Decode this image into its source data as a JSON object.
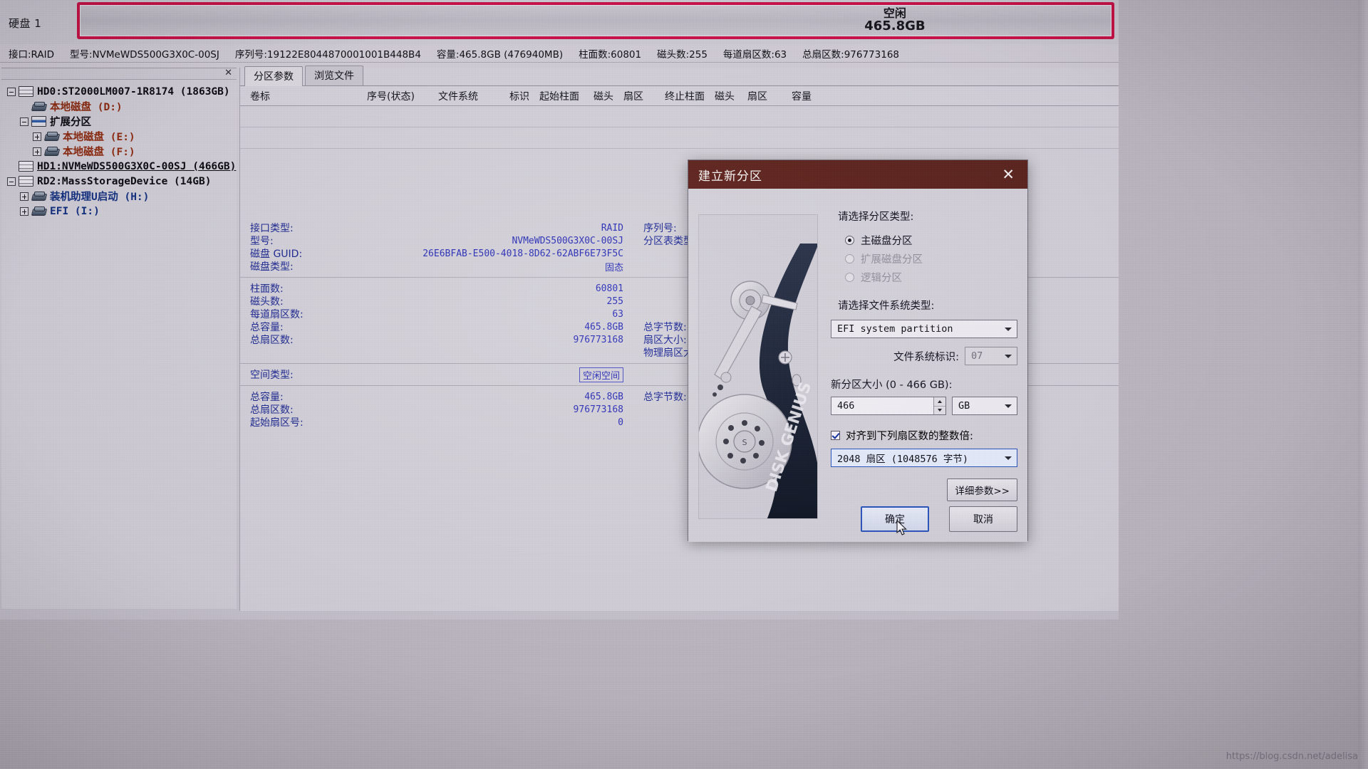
{
  "disk_bar": {
    "label": "硬盘 1",
    "free_title": "空闲",
    "free_size": "465.8GB"
  },
  "info_bar": {
    "interface": "接口:RAID",
    "model": "型号:NVMeWDS500G3X0C-00SJ",
    "serial": "序列号:19122E8044870001001B448B4",
    "capacity": "容量:465.8GB (476940MB)",
    "cylinders": "柱面数:60801",
    "heads": "磁头数:255",
    "sectors_per_track": "每道扇区数:63",
    "total_sectors": "总扇区数:976773168"
  },
  "tree": {
    "items": [
      {
        "label": "HD0:ST2000LM007-1R8174 (1863GB)",
        "icon": "disk-icon",
        "color": "black",
        "indent": 0,
        "expander": "minus"
      },
      {
        "label": "本地磁盘 (D:)",
        "icon": "hdd-icon",
        "color": "red",
        "indent": 1,
        "expander": "none"
      },
      {
        "label": "扩展分区",
        "icon": "ext-icon",
        "color": "black",
        "indent": 1,
        "expander": "minus"
      },
      {
        "label": "本地磁盘 (E:)",
        "icon": "hdd-icon",
        "color": "red",
        "indent": 2,
        "expander": "plus"
      },
      {
        "label": "本地磁盘 (F:)",
        "icon": "hdd-icon",
        "color": "red",
        "indent": 2,
        "expander": "plus"
      },
      {
        "label": "HD1:NVMeWDS500G3X0C-00SJ (466GB)",
        "icon": "disk-icon",
        "color": "black",
        "indent": 0,
        "expander": "none",
        "selected": true
      },
      {
        "label": "RD2:MassStorageDevice (14GB)",
        "icon": "disk-icon",
        "color": "black",
        "indent": 0,
        "expander": "minus"
      },
      {
        "label": "装机助理U启动 (H:)",
        "icon": "hdd-icon",
        "color": "blue",
        "indent": 1,
        "expander": "plus"
      },
      {
        "label": "EFI (I:)",
        "icon": "hdd-icon",
        "color": "blue",
        "indent": 1,
        "expander": "plus"
      }
    ]
  },
  "main": {
    "tabs": [
      {
        "label": "分区参数",
        "active": true
      },
      {
        "label": "浏览文件",
        "active": false
      }
    ],
    "columns": [
      "卷标",
      "序号(状态)",
      "文件系统",
      "标识",
      "起始柱面",
      "磁头",
      "扇区",
      "终止柱面",
      "磁头",
      "扇区",
      "容量"
    ],
    "disk_info": {
      "rows_group1": [
        {
          "label": "接口类型:",
          "value": "RAID",
          "label2": "序列号:",
          "value2": ""
        },
        {
          "label": "型号:",
          "value": "NVMeWDS500G3X0C-00SJ",
          "label2": "分区表类型:",
          "value2": ""
        },
        {
          "label": "磁盘 GUID:",
          "value": "26E6BFAB-E500-4018-8D62-62ABF6E73F5C",
          "label2": "",
          "value2": ""
        },
        {
          "label": "磁盘类型:",
          "value": "固态",
          "label2": "",
          "value2": ""
        }
      ],
      "rows_group2": [
        {
          "label": "柱面数:",
          "value": "60801",
          "label2": "",
          "value2": ""
        },
        {
          "label": "磁头数:",
          "value": "255",
          "label2": "",
          "value2": ""
        },
        {
          "label": "每道扇区数:",
          "value": "63",
          "label2": "",
          "value2": ""
        },
        {
          "label": "总容量:",
          "value": "465.8GB",
          "label2": "总字节数:",
          "value2": ""
        },
        {
          "label": "总扇区数:",
          "value": "976773168",
          "label2": "扇区大小:",
          "value2": ""
        },
        {
          "label": "",
          "value": "",
          "label2": "物理扇区大小:",
          "value2": ""
        }
      ],
      "rows_group3": [
        {
          "label": "空间类型:",
          "value": "空闲空间",
          "label2": "",
          "value2": ""
        }
      ],
      "rows_group4": [
        {
          "label": "总容量:",
          "value": "465.8GB",
          "label2": "总字节数:",
          "value2": ""
        },
        {
          "label": "总扇区数:",
          "value": "976773168",
          "label2": "",
          "value2": ""
        },
        {
          "label": "起始扇区号:",
          "value": "0",
          "label2": "",
          "value2": ""
        }
      ]
    }
  },
  "dialog": {
    "title": "建立新分区",
    "close_icon": "✕",
    "partition_type_label": "请选择分区类型:",
    "partition_types": [
      {
        "label": "主磁盘分区",
        "selected": true,
        "disabled": false
      },
      {
        "label": "扩展磁盘分区",
        "selected": false,
        "disabled": true
      },
      {
        "label": "逻辑分区",
        "selected": false,
        "disabled": true
      }
    ],
    "filesystem_label": "请选择文件系统类型:",
    "filesystem_value": "EFI system partition",
    "fs_id_label": "文件系统标识:",
    "fs_id_value": "07",
    "size_label": "新分区大小 (0 - 466 GB):",
    "size_value": "466",
    "size_unit": "GB",
    "align_checkbox_label": "对齐到下列扇区数的整数倍:",
    "align_checked": true,
    "align_value": "2048 扇区 (1048576 字节)",
    "advanced_button": "详细参数>>",
    "ok_button": "确定",
    "cancel_button": "取消"
  },
  "watermark": "https://blog.csdn.net/adelisa",
  "colors": {
    "title_bar": "#5a2520",
    "disk_bar_border": "#c5134a",
    "accent_blue": "#2b53b8",
    "value_text": "#2b2fb0"
  }
}
